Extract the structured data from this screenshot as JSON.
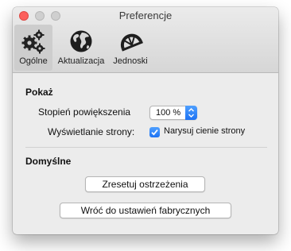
{
  "window": {
    "title": "Preferencje"
  },
  "toolbar": {
    "tabs": [
      {
        "label": "Ogólne",
        "icon": "gears-icon",
        "selected": true
      },
      {
        "label": "Aktualizacja",
        "icon": "globe-icon",
        "selected": false
      },
      {
        "label": "Jednoski",
        "icon": "protractor-icon",
        "selected": false
      }
    ]
  },
  "show_section": {
    "title": "Pokaż",
    "zoom_label": "Stopień powiększenia",
    "zoom_value": "100 %",
    "page_view_label": "Wyświetlanie strony:",
    "shadows_checkbox_label": "Narysuj cienie strony",
    "shadows_checked": true
  },
  "defaults_section": {
    "title": "Domyślne",
    "reset_warnings_label": "Zresetuj ostrzeżenia",
    "factory_reset_label": "Wróć do ustawień fabrycznych"
  },
  "colors": {
    "accent": "#1d72f3",
    "close": "#fc605c"
  }
}
